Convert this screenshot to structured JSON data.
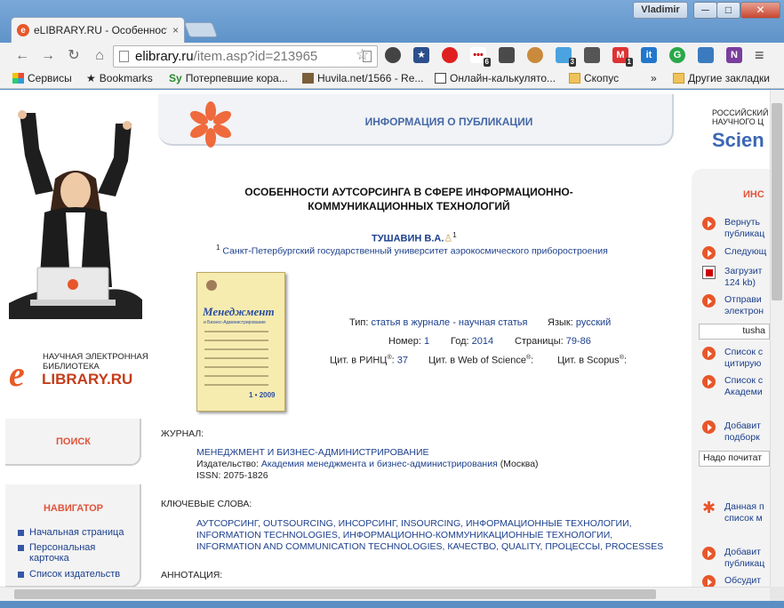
{
  "browser": {
    "tab_title": "eLIBRARY.RU - Особенности аутсорсинга",
    "tab_close": "×",
    "user": "Vladimir",
    "win_min": "─",
    "win_max": "□",
    "win_close": "✕",
    "url_host": "elibrary.ru",
    "url_path": "/item.asp?id=213965",
    "bookmarks": [
      "Сервисы",
      "Bookmarks",
      "Потерпевшие кора...",
      "Huvila.net/1566 - Re...",
      "Онлайн-калькулято...",
      "Скопус"
    ],
    "bookmarks_more": "»",
    "other_bookmarks": "Другие закладки",
    "ext_badges": [
      "6",
      "3",
      "1"
    ]
  },
  "left": {
    "tagline_line1": "НАУЧНАЯ ЭЛЕКТРОННАЯ",
    "tagline_line2": "БИБЛИОТЕКА",
    "logo_letter": "e",
    "logo_name": "LIBRARY.RU",
    "search_label": "ПОИСК",
    "nav_label": "НАВИГАТОР",
    "nav_items": [
      "Начальная страница",
      "Персональная карточка",
      "Список издательств"
    ]
  },
  "header": {
    "section_title": "ИНФОРМАЦИЯ О ПУБЛИКАЦИИ"
  },
  "publication": {
    "title": "ОСОБЕННОСТИ АУТСОРСИНГА В СФЕРЕ ИНФОРМАЦИОННО-КОММУНИКАЦИОННЫХ ТЕХНОЛОГИЙ",
    "author": "ТУШАВИН В.А.",
    "author_sup": "1",
    "affil_sup": "1",
    "affiliation": "Санкт-Петербургский государственный университет аэрокосмического приборостроения",
    "cover": {
      "title": "Менеджмент",
      "subtitle": "и Бизнес-Администрирование",
      "issue": "1 • 2009"
    },
    "type_label": "Тип:",
    "type_value": "статья в журнале - научная статья",
    "lang_label": "Язык:",
    "lang_value": "русский",
    "number_label": "Номер:",
    "number_value": "1",
    "year_label": "Год:",
    "year_value": "2014",
    "pages_label": "Страницы:",
    "pages_value": "79-86",
    "rinc_label": "Цит. в РИНЦ",
    "rinc_value": "37",
    "wos_label": "Цит. в Web of Science",
    "scopus_label": "Цит. в Scopus",
    "reg_mark": "®",
    "colon": ":"
  },
  "journal": {
    "section_label": "ЖУРНАЛ:",
    "name": "МЕНЕДЖМЕНТ И БИЗНЕС-АДМИНИСТРИРОВАНИЕ",
    "publisher_label": "Издательство:",
    "publisher": "Академия менеджмента и бизнес-администрирования",
    "publisher_city": "(Москва)",
    "issn_label": "ISSN:",
    "issn": "2075-1826"
  },
  "keywords": {
    "section_label": "КЛЮЧЕВЫЕ СЛОВА:",
    "lines": [
      "АУТСОРСИНГ, OUTSOURCING, ИНСОРСИНГ, INSOURCING, ИНФОРМАЦИОННЫЕ ТЕХНОЛОГИИ,",
      "INFORMATION TECHNOLOGIES, ИНФОРМАЦИОННО-КОММУНИКАЦИОННЫЕ ТЕХНОЛОГИИ,",
      "INFORMATION AND COMMUNICATION TECHNOLOGIES, КАЧЕСТВО, QUALITY, ПРОЦЕССЫ, PROCESSES"
    ]
  },
  "annotation": {
    "section_label": "АННОТАЦИЯ:"
  },
  "right": {
    "tagline_line1": "РОССИЙСКИЙ",
    "tagline_line2": "НАУЧНОГО Ц",
    "science_fragment": "Scien",
    "box_title": "ИНС",
    "actions": [
      "Вернуть",
      "публикац",
      "Следующ",
      "Загрузит",
      "124 kb)",
      "Отправи",
      "электрон",
      "Список с",
      "цитирую",
      "Список с",
      "Академи",
      "Добавит",
      "подборк",
      "Данная п",
      "список м",
      "Добавит",
      "публикац",
      "Обсудит"
    ],
    "input_value": "tusha",
    "select_value": "Надо почитат"
  },
  "colors": {
    "accent_orange": "#e8562a",
    "link_blue": "#1b3f8c",
    "header_blue": "#4668a7"
  }
}
